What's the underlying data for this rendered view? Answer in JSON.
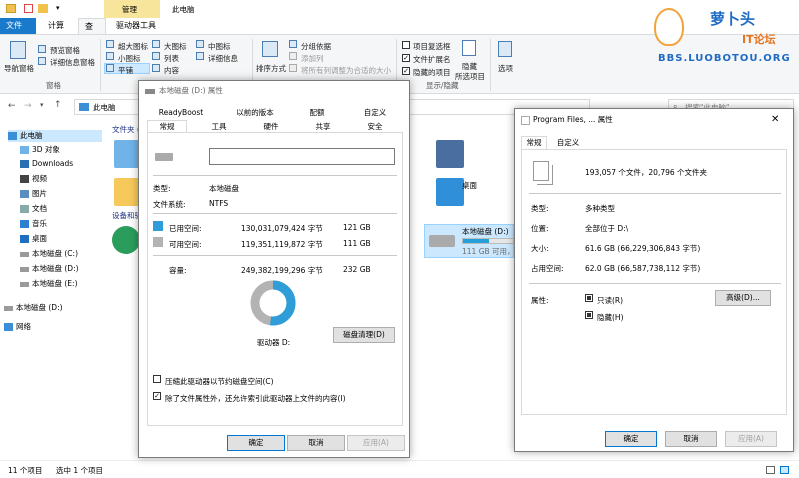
{
  "explorer": {
    "quick_access_tab": "管理",
    "title": "此电脑",
    "tabs": [
      "文件",
      "计算机",
      "查看",
      "驱动器工具"
    ],
    "ribbon": {
      "nav_pane": "导航窗格",
      "preview_pane": "预览窗格",
      "details_pane": "详细信息窗格",
      "pane_group": "窗格",
      "xl_icons": "超大图标",
      "large_icons": "大图标",
      "medium_icons": "中图标",
      "small_icons": "小图标",
      "list": "列表",
      "details": "详细信息",
      "tiles": "平铺",
      "content": "内容",
      "sort": "排序方式",
      "group_by": "分组依据",
      "add_col": "添加列",
      "fit_cols": "将所有列调整为合适的大小",
      "item_checkboxes": "项目复选框",
      "file_ext": "文件扩展名",
      "hidden_items": "隐藏的项目",
      "hide_sel1": "隐藏",
      "hide_sel2": "所选项目",
      "options": "选项",
      "show_hide": "显示/隐藏"
    },
    "address": "此电脑",
    "search_placeholder": "搜索\"此电脑\"",
    "section_folders": "文件夹 (",
    "section_devices": "设备和驱",
    "nav": [
      "此电脑",
      "3D 对象",
      "Downloads",
      "视频",
      "图片",
      "文档",
      "音乐",
      "桌面",
      "本地磁盘 (C:)",
      "本地磁盘 (D:)",
      "本地磁盘 (E:)",
      "本地磁盘 (D:)",
      "网络"
    ],
    "desktop_label": "桌面",
    "drive_d": {
      "name": "本地磁盘 (D:)",
      "free": "111 GB 可用，",
      "fill_pct": 52
    },
    "status_count": "11 个项目",
    "status_sel": "选中 1 个项目"
  },
  "dlg1": {
    "title": "本地磁盘 (D:) 属性",
    "tabs_top": [
      "ReadyBoost",
      "以前的版本",
      "配额",
      "自定义"
    ],
    "tabs_bottom": [
      "常规",
      "工具",
      "硬件",
      "共享",
      "安全"
    ],
    "type_label": "类型:",
    "type_value": "本地磁盘",
    "fs_label": "文件系统:",
    "fs_value": "NTFS",
    "used_label": "已用空间:",
    "used_bytes": "130,031,079,424 字节",
    "used_gb": "121 GB",
    "free_label": "可用空间:",
    "free_bytes": "119,351,119,872 字节",
    "free_gb": "111 GB",
    "cap_label": "容量:",
    "cap_bytes": "249,382,199,296 字节",
    "cap_gb": "232 GB",
    "drive_label": "驱动器 D:",
    "cleanup": "磁盘清理(D)",
    "compress": "压缩此驱动器以节约磁盘空间(C)",
    "index": "除了文件属性外，还允许索引此驱动器上文件的内容(I)",
    "ok": "确定",
    "cancel": "取消",
    "apply": "应用(A)",
    "used_fraction": 0.521,
    "colors": {
      "used": "#2f9ed8",
      "free": "#b3b3b3"
    }
  },
  "dlg2": {
    "title": "Program Files, ... 属性",
    "tabs": [
      "常规",
      "自定义"
    ],
    "count": "193,057 个文件，20,796 个文件夹",
    "type_label": "类型:",
    "type_value": "多种类型",
    "loc_label": "位置:",
    "loc_value": "全部位于 D:\\",
    "size_label": "大小:",
    "size_value": "61.6 GB (66,229,306,843 字节)",
    "disk_label": "占用空间:",
    "disk_value": "62.0 GB (66,587,738,112 字节)",
    "attr_label": "属性:",
    "readonly": "只读(R)",
    "hidden": "隐藏(H)",
    "advanced": "高级(D)...",
    "ok": "确定",
    "cancel": "取消",
    "apply": "应用(A)"
  },
  "watermark": {
    "line1": "萝卜头",
    "line2": "IT论坛",
    "url": "BBS.LUOBOTOU.ORG"
  }
}
